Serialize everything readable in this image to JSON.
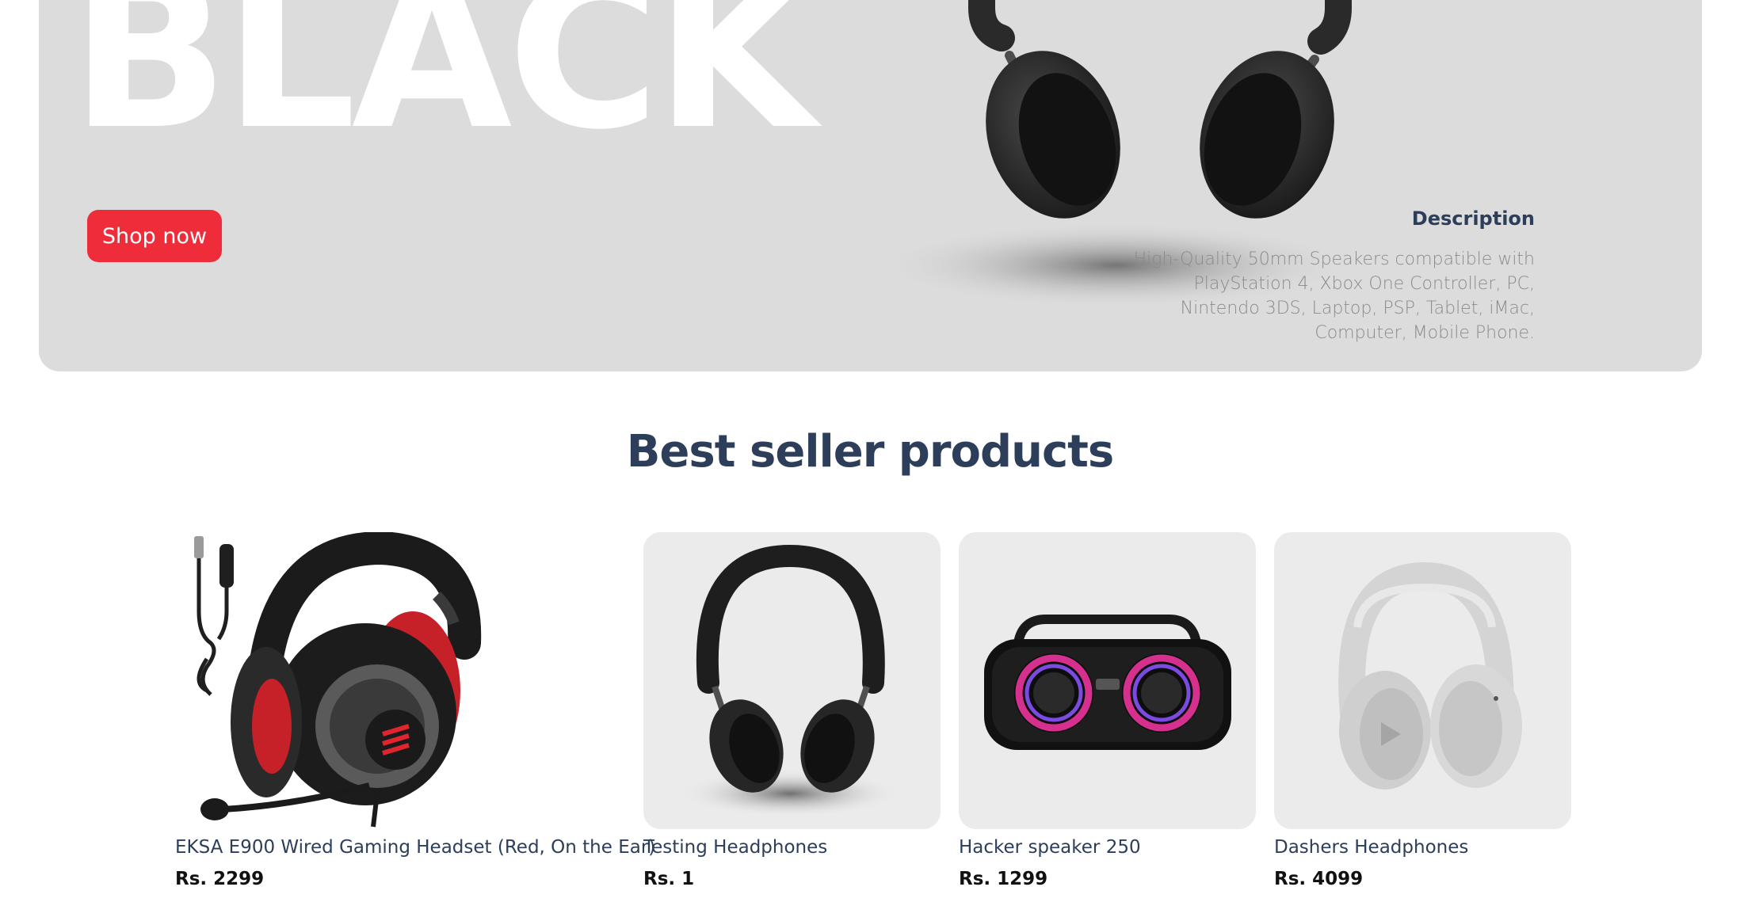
{
  "hero": {
    "title": "BLACK",
    "shop_button": "Shop now",
    "description_title": "Description",
    "description_text": "High-Quality 50mm Speakers compatible with PlayStation 4, Xbox One Controller, PC, Nintendo 3DS, Laptop, PSP, Tablet, iMac, Computer, Mobile Phone.",
    "image_icon": "black-headphones-icon"
  },
  "section": {
    "title": "Best seller products"
  },
  "products": [
    {
      "name": "EKSA E900 Wired Gaming Headset (Red, On the Ear)",
      "price": "Rs. 2299",
      "icon": "gaming-headset-icon"
    },
    {
      "name": "Testing Headphones",
      "price": "Rs. 1",
      "icon": "black-headphones-icon"
    },
    {
      "name": "Hacker speaker 250",
      "price": "Rs. 1299",
      "icon": "bluetooth-speaker-icon"
    },
    {
      "name": "Dashers Headphones",
      "price": "Rs. 4099",
      "icon": "white-headphones-icon"
    }
  ],
  "colors": {
    "hero_bg": "#dcdcdc",
    "accent": "#ef2d3a",
    "heading": "#2c3e5a",
    "card_bg": "#ebebeb"
  }
}
